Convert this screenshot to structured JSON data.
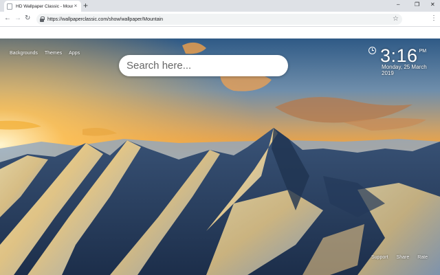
{
  "browser": {
    "tab_title": "HD Wallpaper Classic - Mountain",
    "tab_close": "×",
    "new_tab": "+",
    "url": "https://wallpaperclassic.com/show/wallpaper/Mountain",
    "back": "←",
    "forward": "→",
    "reload": "↻",
    "star": "☆",
    "menu": "⋮",
    "minimize": "–",
    "restore": "❐",
    "close": "✕"
  },
  "page": {
    "top_links": [
      "Backgrounds",
      "Themes",
      "Apps"
    ],
    "search_placeholder": "Search here...",
    "clock": {
      "time": "3:16",
      "ampm": "PM",
      "date": "Monday, 25 March 2019"
    },
    "bottom_links": [
      "Support",
      "Share",
      "Rate"
    ]
  },
  "icons": {
    "favicon": "page-icon",
    "lock": "lock-icon",
    "clock": "clock-icon"
  }
}
